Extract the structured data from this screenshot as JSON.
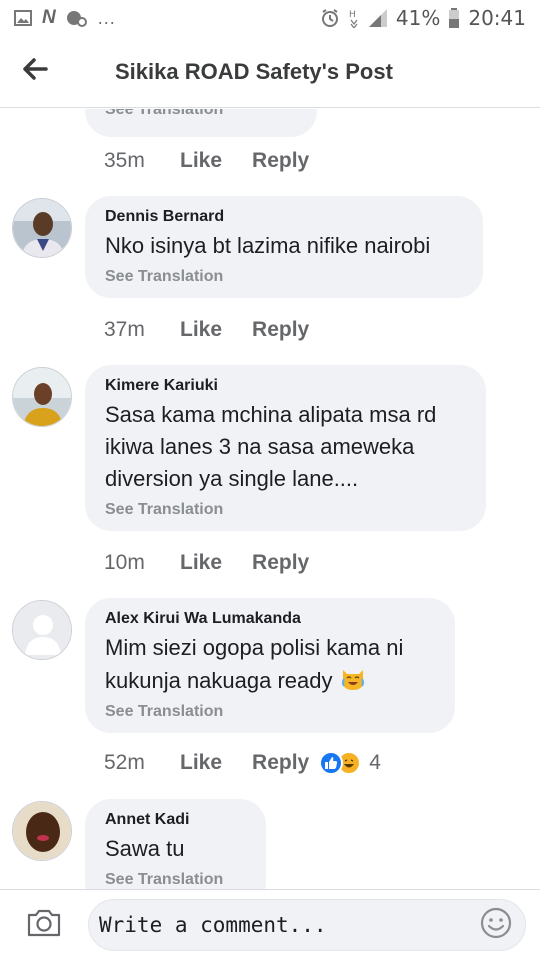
{
  "status_bar": {
    "battery": "41%",
    "time": "20:41",
    "overflow": "..."
  },
  "header": {
    "title": "Sikika ROAD Safety's Post"
  },
  "comments": [
    {
      "author": "",
      "text": "",
      "translation_label": "See Translation",
      "time": "35m",
      "like_label": "Like",
      "reply_label": "Reply"
    },
    {
      "author": "Dennis Bernard",
      "text": "Nko isinya bt lazima nifike nairobi",
      "translation_label": "See Translation",
      "time": "37m",
      "like_label": "Like",
      "reply_label": "Reply"
    },
    {
      "author": "Kimere Kariuki",
      "text": "Sasa kama mchina alipata msa rd ikiwa lanes 3 na sasa ameweka diversion ya single lane....",
      "translation_label": "See Translation",
      "time": "10m",
      "like_label": "Like",
      "reply_label": "Reply"
    },
    {
      "author": "Alex Kirui Wa Lumakanda",
      "text": "Mim siezi ogopa polisi kama ni kukunja nakuaga ready",
      "translation_label": "See Translation",
      "time": "52m",
      "like_label": "Like",
      "reply_label": "Reply",
      "reaction_count": "4",
      "reaction_icons": [
        "like-icon",
        "haha-icon"
      ]
    },
    {
      "author": "Annet Kadi",
      "text": "Sawa tu",
      "translation_label": "See Translation"
    }
  ],
  "composer": {
    "placeholder": "Write a comment..."
  },
  "colors": {
    "bubble": "#f0f2f5",
    "like_blue": "#1877f2",
    "haha_yellow": "#f7b125",
    "secondary_text": "#65676b"
  }
}
